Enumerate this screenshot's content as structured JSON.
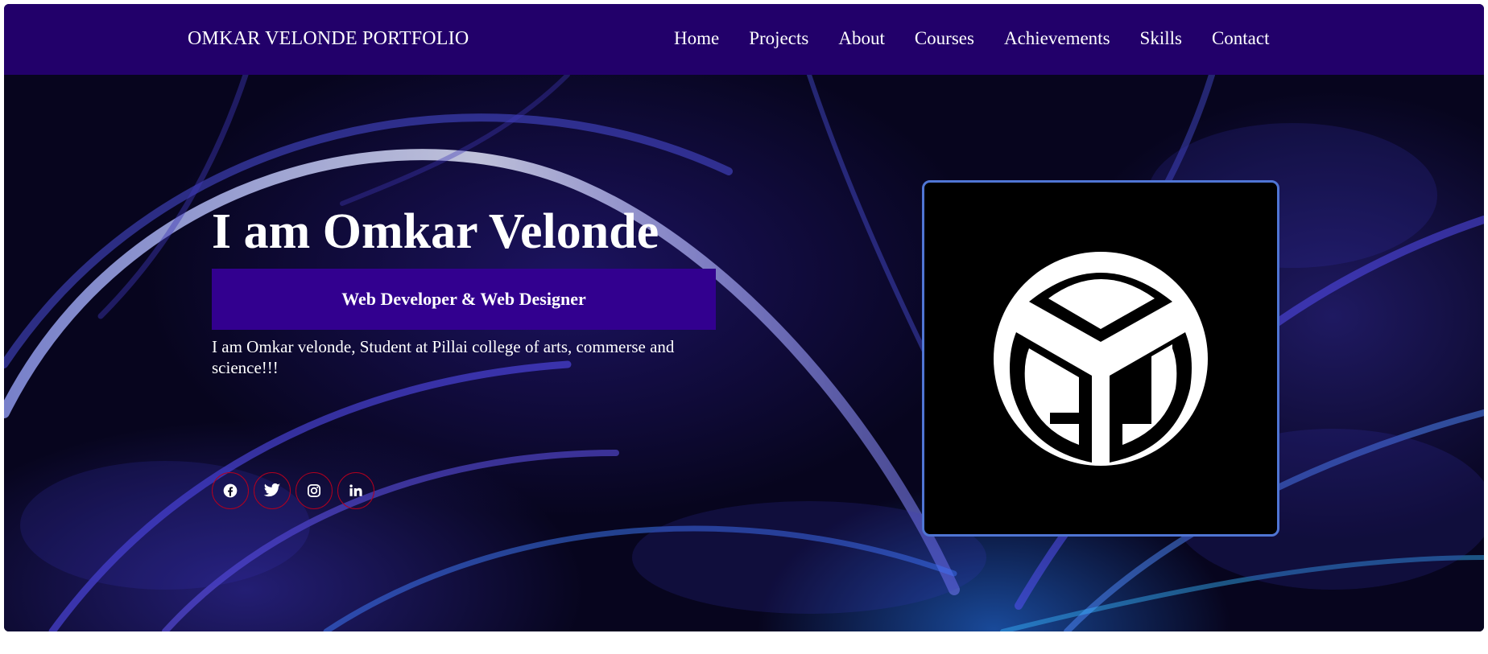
{
  "nav": {
    "brand": "OMKAR VELONDE PORTFOLIO",
    "links": [
      "Home",
      "Projects",
      "About",
      "Courses",
      "Achievements",
      "Skills",
      "Contact"
    ]
  },
  "hero": {
    "title": "I am Omkar Velonde",
    "role": "Web Developer & Web Designer",
    "description": "I am Omkar velonde, Student at Pillai college of arts, commerse and science!!!",
    "socials": [
      "facebook-icon",
      "twitter-icon",
      "instagram-icon",
      "linkedin-icon"
    ]
  },
  "colors": {
    "navbar": "#22006a",
    "role_badge": "#32008f",
    "logo_border": "#4f75d4",
    "social_border": "#b0001f"
  }
}
